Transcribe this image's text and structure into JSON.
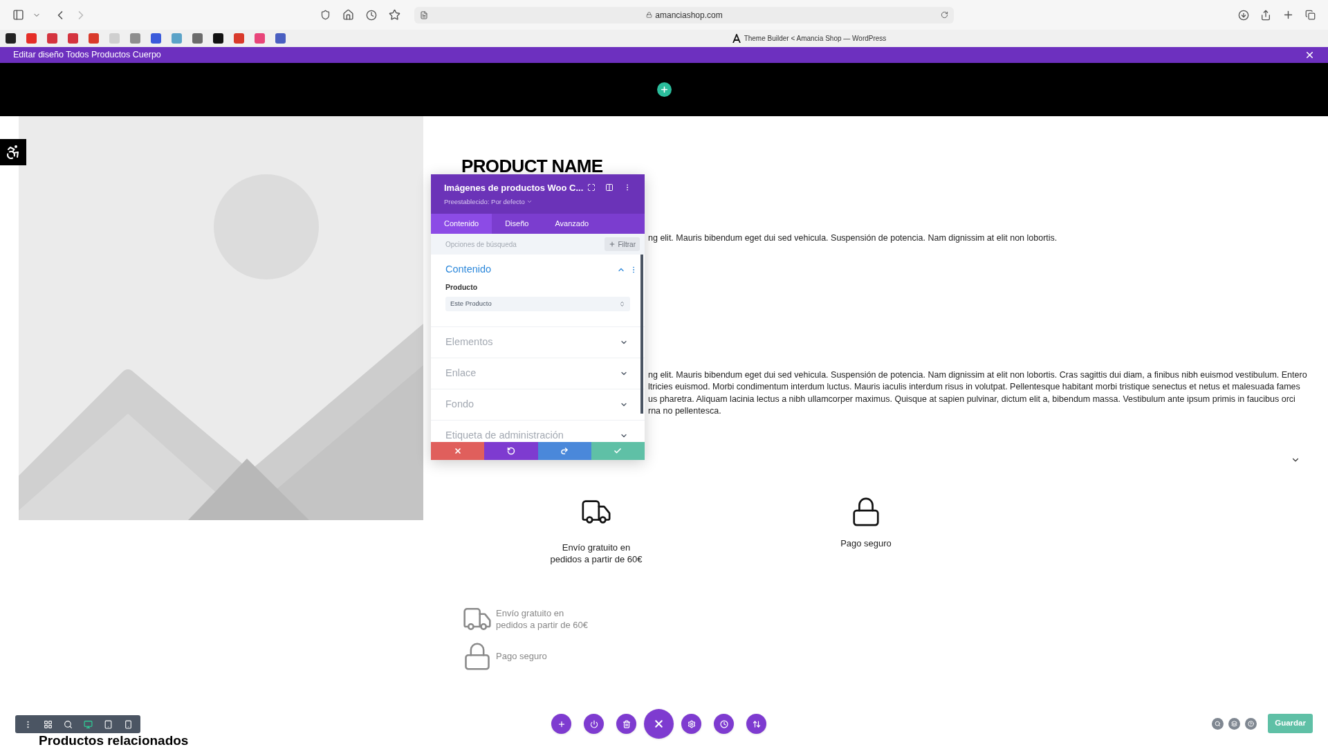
{
  "browser": {
    "url": "amanciashop.com",
    "tab_title": "Theme Builder < Amancia Shop — WordPress"
  },
  "edit_bar": {
    "title": "Editar diseño Todos Productos Cuerpo"
  },
  "product": {
    "name": "PRODUCT NAME",
    "short_description": "ng elit. Mauris bibendum eget dui sed vehicula. Suspensión de potencia. Nam dignissim at elit non lobortis.",
    "description_lines": [
      "ng elit. Mauris bibendum eget dui sed vehicula. Suspensión de potencia. Nam dignissim at elit non lobortis. Cras sagittis dui diam, a finibus nibh euismod vestibulum. Entero",
      "ltricies euismod. Morbi condimentum interdum luctus. Mauris iaculis interdum risus in volutpat. Pellentesque habitant morbi tristique senectus et netus et malesuada fames",
      "us pharetra. Aliquam lacinia lectus a nibh ullamcorper maximus. Quisque at sapien pulvinar, dictum elit a, bibendum massa. Vestibulum ante ipsum primis in faucibus orci",
      "rna no pellentesca."
    ]
  },
  "features": [
    {
      "kind": "truck",
      "lines": [
        "Envío gratuito en",
        "pedidos a partir de 60€"
      ]
    },
    {
      "kind": "lock",
      "lines": [
        "Pago seguro"
      ]
    }
  ],
  "feature_list": [
    {
      "kind": "truck",
      "lines": [
        "Envío gratuito en",
        "pedidos a partir de 60€"
      ]
    },
    {
      "kind": "lock",
      "lines": [
        "Pago seguro"
      ]
    }
  ],
  "panel": {
    "title": "Imágenes de productos Woo C...",
    "preset": "Preestablecido: Por defecto",
    "tabs": [
      {
        "label": "Contenido",
        "selected": true
      },
      {
        "label": "Diseño",
        "selected": false
      },
      {
        "label": "Avanzado",
        "selected": false
      }
    ],
    "search": {
      "placeholder": "Opciones de búsqueda"
    },
    "filter_button": "Filtrar",
    "sections": [
      {
        "title": "Contenido",
        "expanded": true,
        "fields": [
          {
            "label": "Producto",
            "value": "Este Producto"
          }
        ]
      },
      {
        "title": "Elementos",
        "expanded": false
      },
      {
        "title": "Enlace",
        "expanded": false
      },
      {
        "title": "Fondo",
        "expanded": false
      },
      {
        "title": "Etiqueta de administración",
        "expanded": false
      }
    ]
  },
  "view_modes": [
    {
      "kind": "menu",
      "selected": false
    },
    {
      "kind": "wireframe",
      "selected": false
    },
    {
      "kind": "zoom",
      "selected": false
    },
    {
      "kind": "desktop",
      "selected": true
    },
    {
      "kind": "tablet",
      "selected": false
    },
    {
      "kind": "phone",
      "selected": false
    }
  ],
  "related_heading": "Productos relacionados",
  "save_button": "Guardar"
}
